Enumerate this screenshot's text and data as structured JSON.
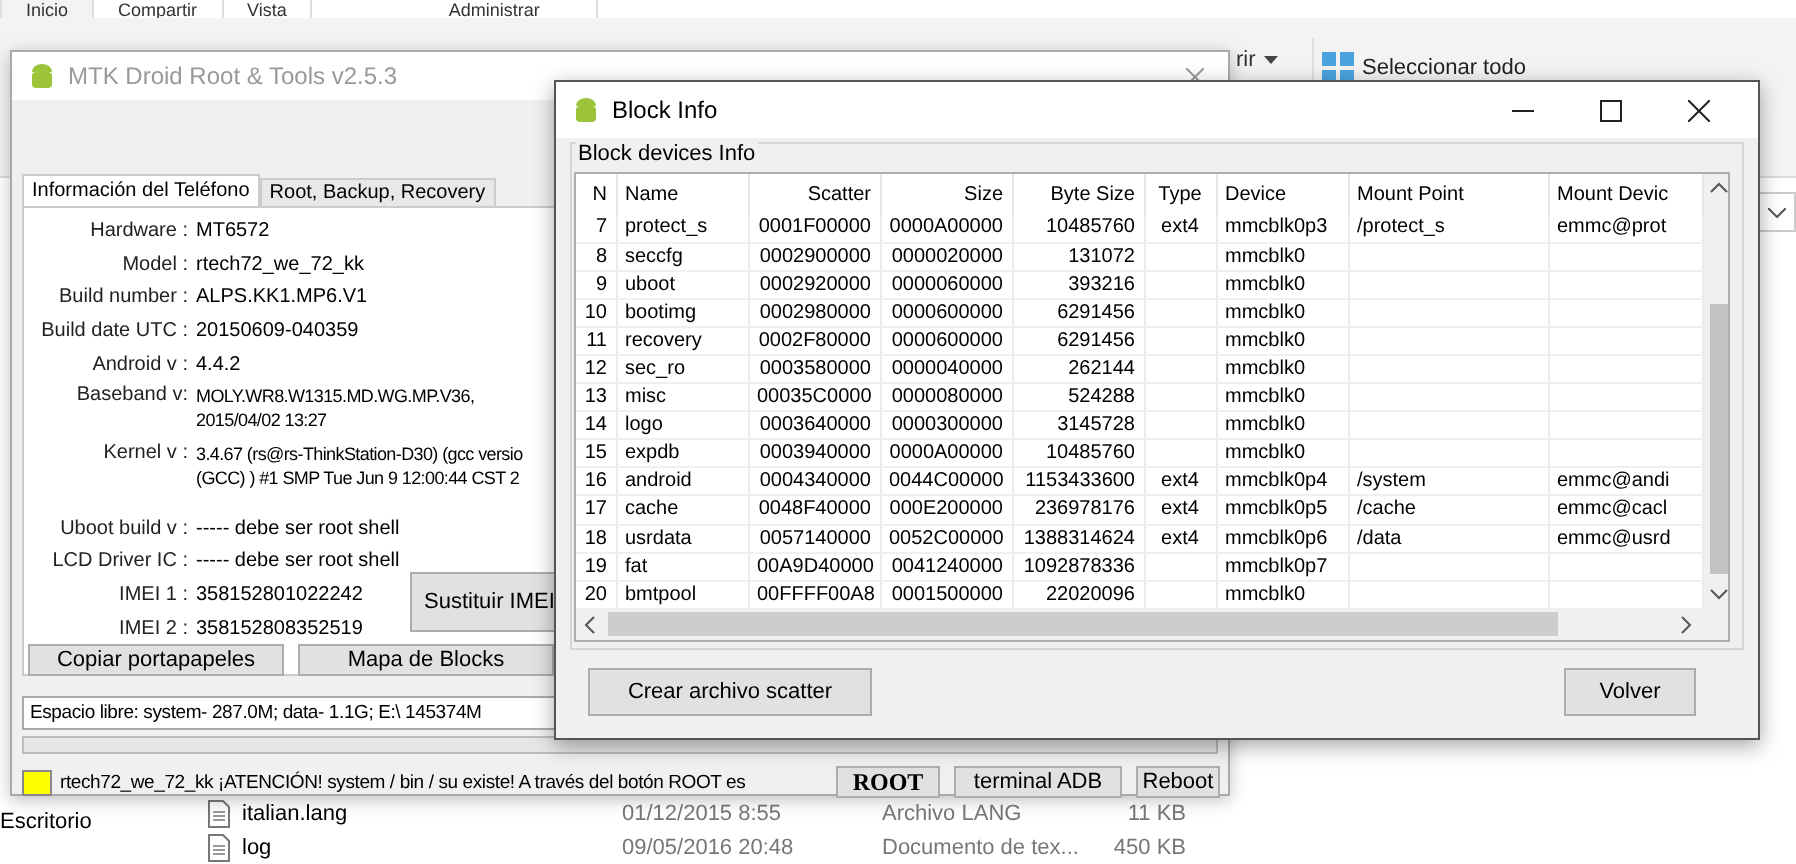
{
  "explorer": {
    "ribbon_tabs": [
      {
        "label": "Inicio",
        "selected": true
      },
      {
        "label": "Compartir",
        "selected": false
      },
      {
        "label": "Vista",
        "selected": false
      },
      {
        "label": "Administrar",
        "selected": false
      }
    ],
    "open_item": "rir",
    "select_all": "Seleccionar todo",
    "nav_item": "Escritorio",
    "files": [
      {
        "name": "italian.lang",
        "date": "01/12/2015 8:55",
        "type": "Archivo LANG",
        "size": "11 KB"
      },
      {
        "name": "log",
        "date": "09/05/2016 20:48",
        "type": "Documento de tex...",
        "size": "450 KB"
      }
    ]
  },
  "mtk_window": {
    "title": "MTK Droid Root & Tools v2.5.3",
    "tabs": [
      {
        "label": "Información del Teléfono",
        "selected": true
      },
      {
        "label": "Root, Backup, Recovery",
        "selected": false
      }
    ],
    "fields": [
      {
        "label": "Hardware :",
        "lines": [
          "MT6572"
        ]
      },
      {
        "label": "Model :",
        "lines": [
          "rtech72_we_72_kk"
        ]
      },
      {
        "label": "Build number :",
        "lines": [
          "ALPS.KK1.MP6.V1"
        ]
      },
      {
        "label": "Build date UTC :",
        "lines": [
          "20150609-040359"
        ]
      },
      {
        "label": "Android  v :",
        "lines": [
          "4.4.2"
        ]
      },
      {
        "label": "Baseband v:",
        "lines": [
          "MOLY.WR8.W1315.MD.WG.MP.V36,",
          "2015/04/02 13:27"
        ]
      },
      {
        "label": "Kernel v :",
        "lines": [
          "3.4.67 (rs@rs-ThinkStation-D30) (gcc versio",
          "(GCC) ) #1 SMP  Tue Jun 9 12:00:44 CST 2"
        ]
      },
      {
        "label": "Uboot build v :",
        "lines": [
          "----- debe ser  root shell"
        ]
      },
      {
        "label": "LCD Driver IC :",
        "lines": [
          "----- debe ser  root shell"
        ]
      },
      {
        "label": "IMEI 1 :",
        "lines": [
          "358152801022242"
        ]
      },
      {
        "label": "IMEI 2 :",
        "lines": [
          "358152808352519"
        ]
      }
    ],
    "imei_button": "Sustituir IMEI",
    "panel_buttons": [
      "Copiar portapapeles",
      "Mapa de Blocks"
    ],
    "free_space": "Espacio libre: system- 287.0M; data- 1.1G;  E:\\ 145374M",
    "message": "rtech72_we_72_kk ¡ATENCIÓN! system / bin / su existe! A través del botón ROOT es",
    "action_buttons": [
      {
        "label": "ROOT",
        "kind": "bold"
      },
      {
        "label": "terminal ADB",
        "kind": "plain"
      },
      {
        "label": "Reboot",
        "kind": "plain"
      }
    ]
  },
  "block_info": {
    "title": "Block Info",
    "group": "Block devices Info",
    "columns": [
      "N",
      "Name",
      "Scatter",
      "Size",
      "Byte Size",
      "Type",
      "Device",
      "Mount Point",
      "Mount Devic"
    ],
    "rows": [
      [
        "7",
        "protect_s",
        "0001F00000",
        "0000A00000",
        "10485760",
        "ext4",
        "mmcblk0p3",
        "/protect_s",
        "emmc@prot"
      ],
      [
        "8",
        "seccfg",
        "0002900000",
        "0000020000",
        "131072",
        "",
        "mmcblk0",
        "",
        ""
      ],
      [
        "9",
        "uboot",
        "0002920000",
        "0000060000",
        "393216",
        "",
        "mmcblk0",
        "",
        ""
      ],
      [
        "10",
        "bootimg",
        "0002980000",
        "0000600000",
        "6291456",
        "",
        "mmcblk0",
        "",
        ""
      ],
      [
        "11",
        "recovery",
        "0002F80000",
        "0000600000",
        "6291456",
        "",
        "mmcblk0",
        "",
        ""
      ],
      [
        "12",
        "sec_ro",
        "0003580000",
        "0000040000",
        "262144",
        "",
        "mmcblk0",
        "",
        ""
      ],
      [
        "13",
        "misc",
        "00035C0000",
        "0000080000",
        "524288",
        "",
        "mmcblk0",
        "",
        ""
      ],
      [
        "14",
        "logo",
        "0003640000",
        "0000300000",
        "3145728",
        "",
        "mmcblk0",
        "",
        ""
      ],
      [
        "15",
        "expdb",
        "0003940000",
        "0000A00000",
        "10485760",
        "",
        "mmcblk0",
        "",
        ""
      ],
      [
        "16",
        "android",
        "0004340000",
        "0044C00000",
        "1153433600",
        "ext4",
        "mmcblk0p4",
        "/system",
        "emmc@andi"
      ],
      [
        "17",
        "cache",
        "0048F40000",
        "000E200000",
        "236978176",
        "ext4",
        "mmcblk0p5",
        "/cache",
        "emmc@cacl"
      ],
      [
        "18",
        "usrdata",
        "0057140000",
        "0052C00000",
        "1388314624",
        "ext4",
        "mmcblk0p6",
        "/data",
        "emmc@usrd"
      ],
      [
        "19",
        "fat",
        "00A9D40000",
        "0041240000",
        "1092878336",
        "",
        "mmcblk0p7",
        "",
        ""
      ],
      [
        "20",
        "bmtpool",
        "00FFFF00A8",
        "0001500000",
        "22020096",
        "",
        "mmcblk0",
        "",
        ""
      ]
    ],
    "buttons": [
      "Crear archivo scatter",
      "Volver"
    ]
  }
}
